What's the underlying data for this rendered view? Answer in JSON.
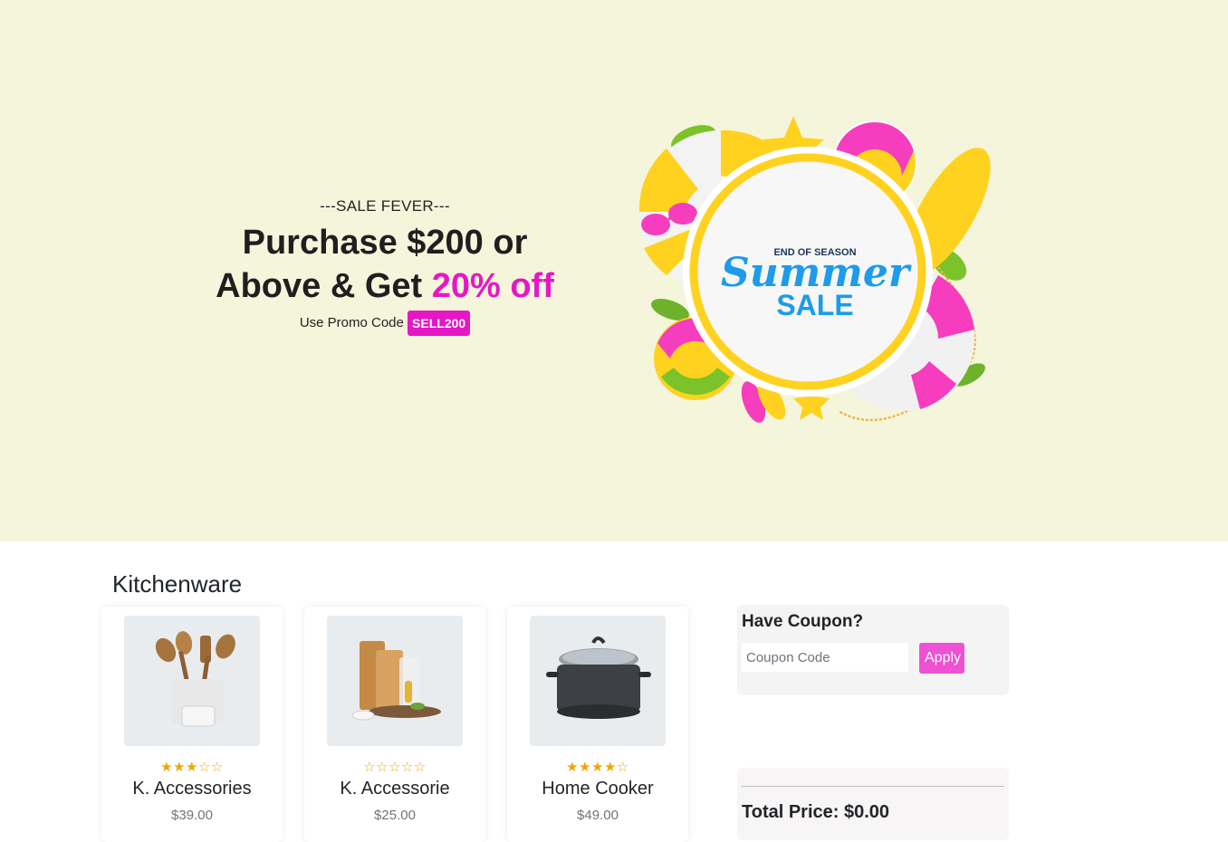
{
  "hero": {
    "tagline": "---SALE FEVER---",
    "headline_line1": "Purchase $200 or",
    "headline_line2_prefix": "Above & Get ",
    "headline_accent": "20% off",
    "promo_label": "Use Promo Code",
    "promo_code": "SELL200",
    "image": {
      "kicker": "END OF SEASON",
      "title": "Summer",
      "subtitle": "SALE"
    }
  },
  "catalog": {
    "title": "Kitchenware",
    "products": [
      {
        "name": "K. Accessories",
        "price": "$39.00",
        "rating": 3,
        "max_rating": 5,
        "icon": "wooden-utensils-icon"
      },
      {
        "name": "K. Accessorie",
        "price": "$25.00",
        "rating": 0,
        "max_rating": 5,
        "icon": "cutting-boards-icon"
      },
      {
        "name": "Home Cooker",
        "price": "$49.00",
        "rating": 4,
        "max_rating": 5,
        "icon": "cooking-pot-icon"
      }
    ]
  },
  "coupon": {
    "title": "Have Coupon?",
    "placeholder": "Coupon Code",
    "apply_label": "Apply"
  },
  "cart": {
    "total_label": "Total Price: $0.00"
  },
  "colors": {
    "hero_bg": "#f5f5dc",
    "accent": "#e617c5",
    "apply_button": "#ee51d3",
    "star": "#f0a500"
  }
}
